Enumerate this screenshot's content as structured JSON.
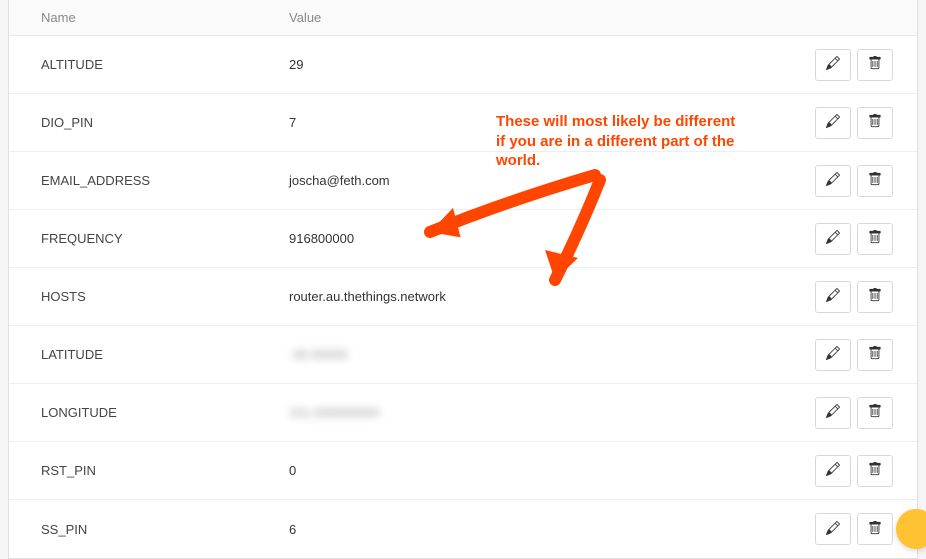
{
  "headers": {
    "name": "Name",
    "value": "Value"
  },
  "rows": [
    {
      "name": "ALTITUDE",
      "value": "29",
      "blur": false
    },
    {
      "name": "DIO_PIN",
      "value": "7",
      "blur": false
    },
    {
      "name": "EMAIL_ADDRESS",
      "value": "joscha@feth.com",
      "blur": false
    },
    {
      "name": "FREQUENCY",
      "value": "916800000",
      "blur": false
    },
    {
      "name": "HOSTS",
      "value": "router.au.thethings.network",
      "blur": false
    },
    {
      "name": "LATITUDE",
      "value": "-30.00000",
      "blur": true
    },
    {
      "name": "LONGITUDE",
      "value": "151.000000000",
      "blur": true
    },
    {
      "name": "RST_PIN",
      "value": "0",
      "blur": false
    },
    {
      "name": "SS_PIN",
      "value": "6",
      "blur": false
    }
  ],
  "annotation": {
    "line1": "These will most likely be different",
    "line2": "if you are in a different part of the",
    "line3": "world."
  }
}
